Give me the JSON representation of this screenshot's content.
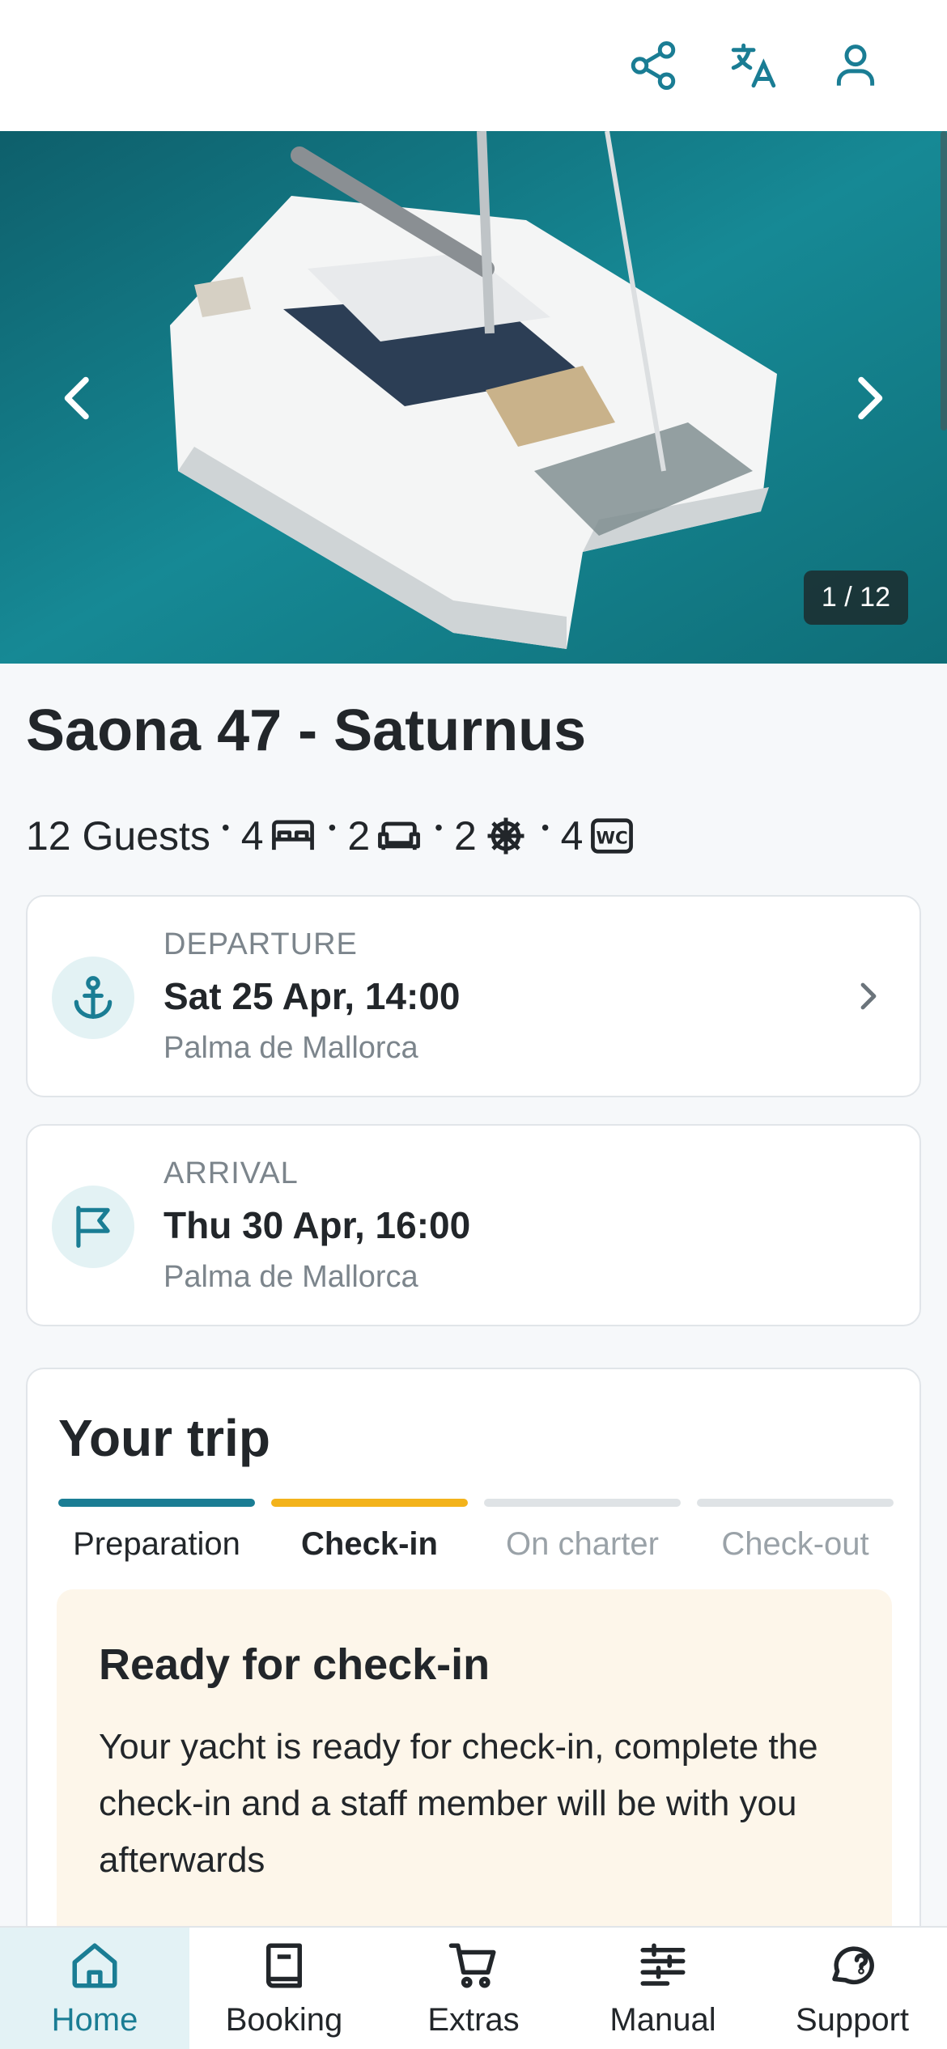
{
  "colors": {
    "accent": "#1a7d94",
    "active_step": "#f3b31b",
    "notice_bg": "#fdf6ea",
    "muted_text": "#7c858c"
  },
  "header": {
    "icons": [
      "share-icon",
      "translate-icon",
      "profile-icon"
    ]
  },
  "gallery": {
    "counter": "1 / 12",
    "prev_icon": "chevron-left-icon",
    "next_icon": "chevron-right-icon"
  },
  "yacht": {
    "name": "Saona 47 - Saturnus",
    "guests": "12 Guests",
    "specs": [
      {
        "count": "4",
        "icon": "bed-icon"
      },
      {
        "count": "2",
        "icon": "sofa-icon"
      },
      {
        "count": "2",
        "icon": "helm-icon"
      },
      {
        "count": "4",
        "icon": "wc-icon"
      }
    ]
  },
  "departure": {
    "label": "DEPARTURE",
    "datetime": "Sat 25 Apr, 14:00",
    "place": "Palma de Mallorca",
    "icon": "anchor-icon"
  },
  "arrival": {
    "label": "ARRIVAL",
    "datetime": "Thu 30 Apr, 16:00",
    "place": "Palma de Mallorca",
    "icon": "flag-icon"
  },
  "trip": {
    "title": "Your trip",
    "steps": [
      {
        "label": "Preparation",
        "state": "done"
      },
      {
        "label": "Check-in",
        "state": "active"
      },
      {
        "label": "On charter",
        "state": "pending"
      },
      {
        "label": "Check-out",
        "state": "pending"
      }
    ],
    "notice": {
      "title": "Ready for check-in",
      "body": "Your yacht is ready for check-in, complete the check-in and a staff member will be with you afterwards"
    }
  },
  "bottom_nav": {
    "items": [
      {
        "label": "Home",
        "icon": "home-icon",
        "active": true
      },
      {
        "label": "Booking",
        "icon": "book-icon",
        "active": false
      },
      {
        "label": "Extras",
        "icon": "cart-icon",
        "active": false
      },
      {
        "label": "Manual",
        "icon": "manual-icon",
        "active": false
      },
      {
        "label": "Support",
        "icon": "chat-icon",
        "active": false
      }
    ]
  }
}
